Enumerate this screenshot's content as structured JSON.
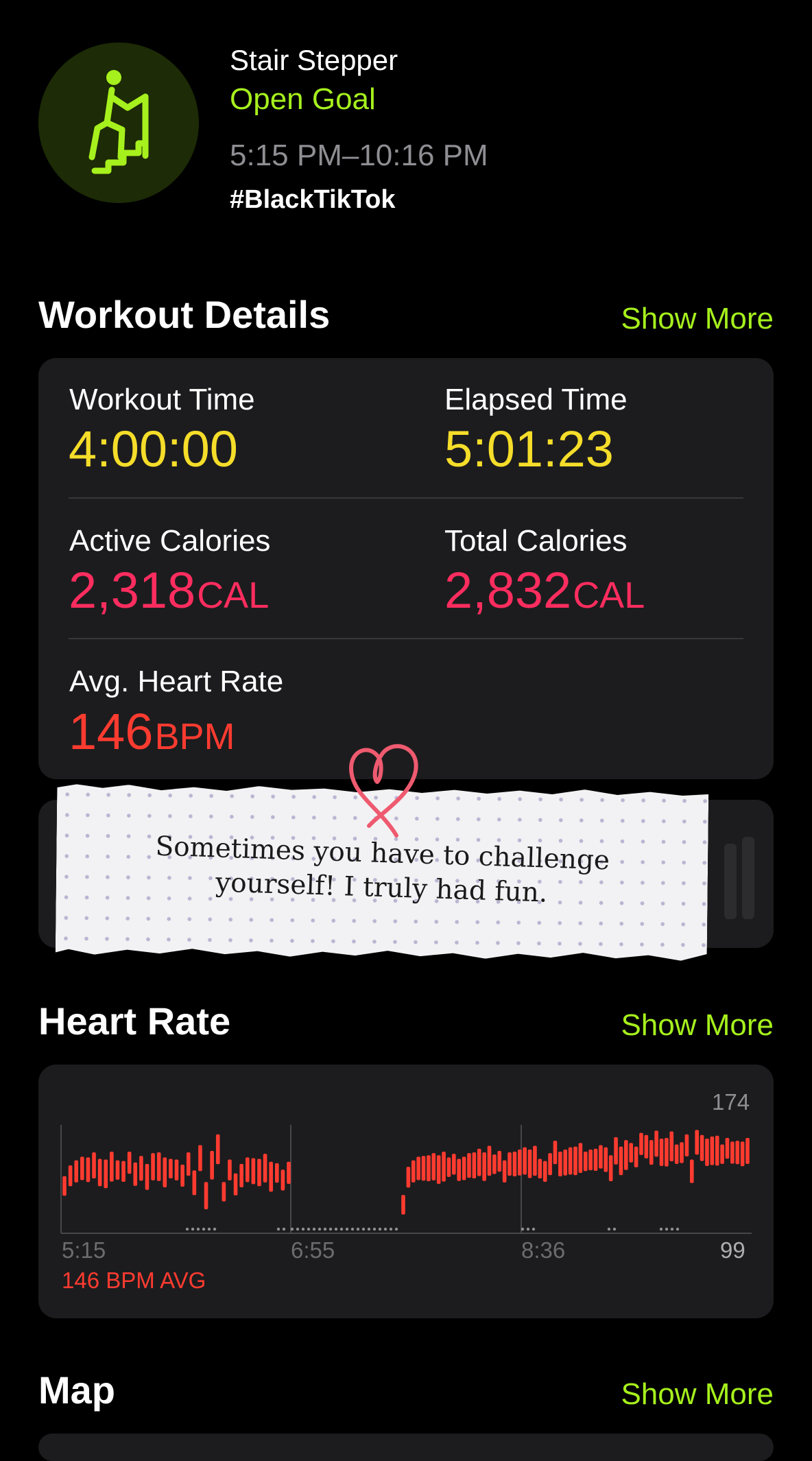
{
  "workout": {
    "title": "Stair Stepper",
    "goal": "Open Goal",
    "time_range": "5:15 PM–10:16 PM",
    "tag": "#BlackTikTok",
    "icon": "stair-stepper-figure-icon"
  },
  "details": {
    "title": "Workout Details",
    "show_more": "Show More",
    "workout_time_label": "Workout Time",
    "workout_time_value": "4:00:00",
    "elapsed_time_label": "Elapsed Time",
    "elapsed_time_value": "5:01:23",
    "active_cal_label": "Active Calories",
    "active_cal_value": "2,318",
    "active_cal_unit": "CAL",
    "total_cal_label": "Total Calories",
    "total_cal_value": "2,832",
    "total_cal_unit": "CAL",
    "avg_hr_label": "Avg. Heart Rate",
    "avg_hr_value": "146",
    "avg_hr_unit": "BPM"
  },
  "note": {
    "line1": "Sometimes you have to challenge",
    "line2": "yourself! I truly had fun.",
    "decoration": "heart-doodle-icon"
  },
  "heart_rate": {
    "title": "Heart Rate",
    "show_more": "Show More",
    "max_label": "174",
    "min_label": "99",
    "x_labels": [
      "5:15",
      "6:55",
      "8:36"
    ],
    "avg_label": "146 BPM AVG"
  },
  "map": {
    "title": "Map",
    "show_more": "Show More"
  },
  "colors": {
    "accent_green": "#a6f01d",
    "time_yellow": "#f5dd2a",
    "calorie_pink": "#ff2d5f",
    "heart_red": "#ff3b30",
    "card_bg": "#1c1c1e"
  },
  "chart_data": {
    "type": "bar",
    "ylim": [
      99,
      174
    ],
    "x_tick_labels": [
      "5:15",
      "6:55",
      "8:36"
    ],
    "segments": [
      {
        "values": [
          135,
          142,
          145,
          147,
          146,
          149,
          144,
          143,
          148,
          146,
          145,
          151,
          143,
          147,
          141,
          148,
          148,
          144,
          147,
          146,
          142,
          150,
          137,
          154,
          128,
          149,
          160,
          131,
          146,
          136,
          142,
          146,
          145,
          144,
          147,
          141,
          144,
          139,
          144
        ],
        "gap_after_x": 7
      },
      {
        "values": [
          122,
          141,
          145,
          147,
          147,
          147,
          148,
          146,
          148,
          148,
          150,
          146,
          147,
          149,
          149,
          151,
          148,
          152,
          150,
          152,
          145,
          150,
          150,
          151,
          152,
          150,
          152,
          147,
          145,
          150,
          158,
          150,
          151,
          152,
          152,
          154,
          152,
          153,
          153,
          155,
          153,
          147,
          159,
          152,
          156,
          158,
          155,
          164,
          162,
          158,
          164,
          158,
          158,
          162,
          157,
          158,
          163,
          145,
          165,
          161,
          158,
          159,
          159,
          157,
          161,
          158,
          158,
          157,
          159
        ],
        "gap_after_x": 0
      }
    ]
  }
}
